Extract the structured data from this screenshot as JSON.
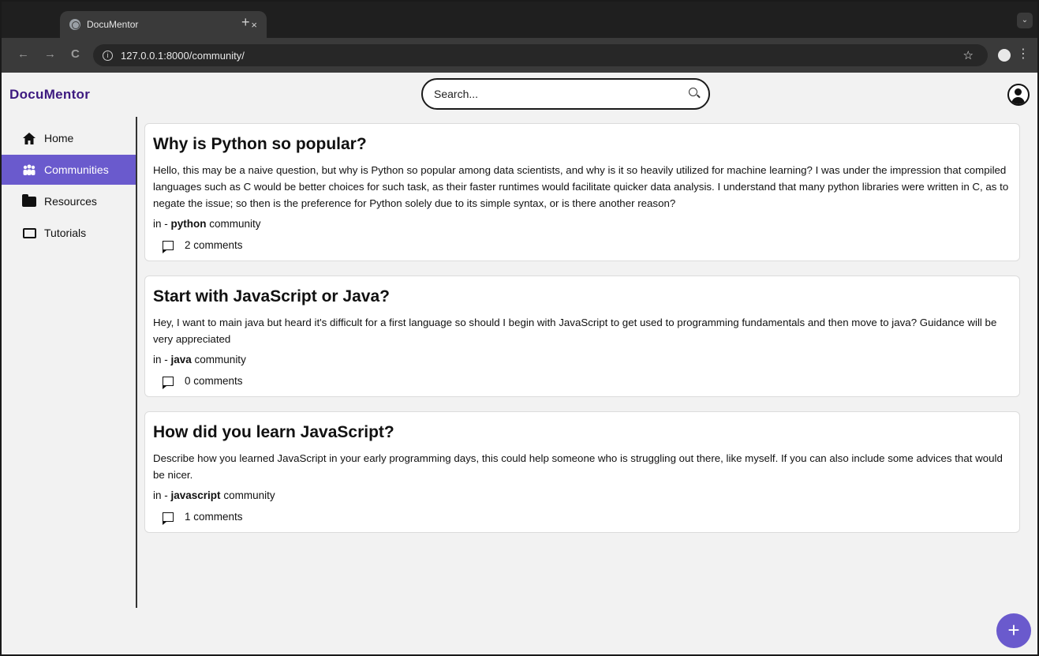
{
  "browser": {
    "tab_title": "DocuMentor",
    "tab_close": "×",
    "new_tab": "+",
    "url": "127.0.0.1:8000/community/",
    "back": "←",
    "forward": "→",
    "reload": "C",
    "bookmark": "☆",
    "menu": "⋮",
    "dropdown": "⌄"
  },
  "app": {
    "logo": "DocuMentor",
    "search_placeholder": "Search..."
  },
  "sidebar": {
    "items": [
      {
        "label": "Home",
        "icon": "home-icon"
      },
      {
        "label": "Communities",
        "icon": "people-icon",
        "active": true
      },
      {
        "label": "Resources",
        "icon": "folder-icon"
      },
      {
        "label": "Tutorials",
        "icon": "tutorial-icon"
      }
    ]
  },
  "posts": [
    {
      "title": "Why is Python so popular?",
      "body": "Hello, this may be a naive question, but why is Python so popular among data scientists, and why is it so heavily utilized for machine learning? I was under the impression that compiled languages such as C would be better choices for such task, as their faster runtimes would facilitate quicker data analysis. I understand that many python libraries were written in C, as to negate the issue; so then is the preference for Python solely due to its simple syntax, or is there another reason?",
      "in_prefix": "in - ",
      "community": "python",
      "community_suffix": " community",
      "comments": "2 comments"
    },
    {
      "title": "Start with JavaScript or Java?",
      "body": "Hey, I want to main java but heard it's difficult for a first language so should I begin with JavaScript to get used to programming fundamentals and then move to java? Guidance will be very appreciated",
      "in_prefix": "in - ",
      "community": "java",
      "community_suffix": " community",
      "comments": "0 comments"
    },
    {
      "title": "How did you learn JavaScript?",
      "body": "Describe how you learned JavaScript in your early programming days, this could help someone who is struggling out there, like myself. If you can also include some advices that would be nicer.",
      "in_prefix": "in - ",
      "community": "javascript",
      "community_suffix": " community",
      "comments": "1 comments"
    }
  ],
  "fab_label": "+",
  "colors": {
    "accent": "#6a5acd",
    "logo": "#3d1a80"
  }
}
